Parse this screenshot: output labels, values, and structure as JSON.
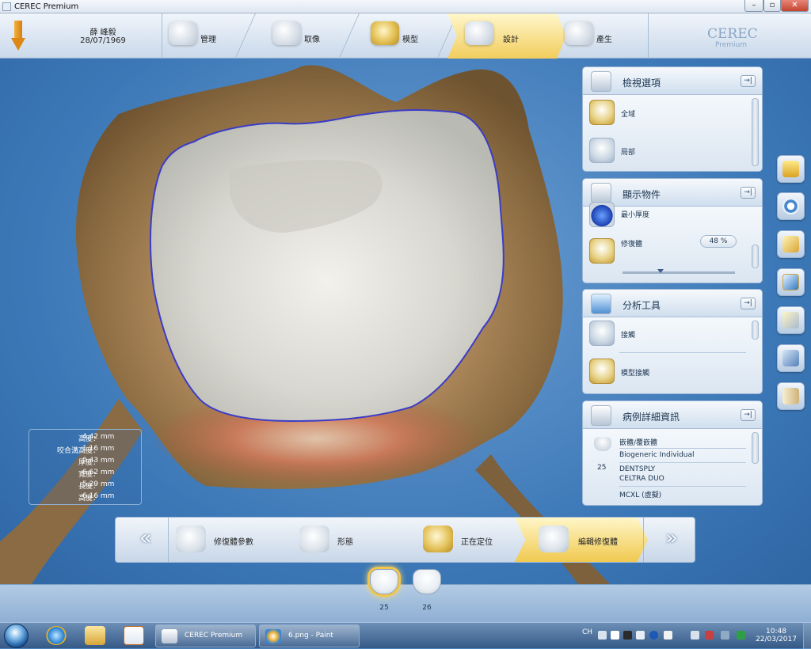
{
  "window": {
    "title": "CEREC Premium",
    "minimize": "–",
    "maximize": "▫",
    "close": "✕"
  },
  "patient": {
    "name": "薛 峰毅",
    "dob": "28/07/1969"
  },
  "workflow": {
    "steps": [
      {
        "label": "管理"
      },
      {
        "label": "取像"
      },
      {
        "label": "模型"
      },
      {
        "label": "設計",
        "active": true
      },
      {
        "label": "產生"
      }
    ]
  },
  "brand": {
    "logo": "CEREC",
    "sub": "Premium"
  },
  "measurements": [
    {
      "label": "高度：",
      "value": "4.42 mm"
    },
    {
      "label": "咬合溝高度：",
      "value": "1.16 mm"
    },
    {
      "label": "厚度：",
      "value": "0.43 mm"
    },
    {
      "label": "寬度：",
      "value": "6.62 mm"
    },
    {
      "label": "長度：",
      "value": "5.29 mm"
    },
    {
      "label": "高度：",
      "value": "6.16 mm"
    }
  ],
  "panels": {
    "view_options": {
      "title": "檢視選項",
      "items": [
        {
          "label": "全域"
        },
        {
          "label": "局部"
        }
      ]
    },
    "display_objects": {
      "title": "顯示物件",
      "items": [
        {
          "label": "最小厚度"
        },
        {
          "label": "修復體",
          "value": "48 %"
        }
      ],
      "transparency_level": 0.48
    },
    "analysis_tools": {
      "title": "分析工具",
      "items": [
        {
          "label": "接觸"
        },
        {
          "label": "模型接觸"
        }
      ]
    },
    "case_details": {
      "title": "病例詳細資訊",
      "type": "嵌體/覆嵌體",
      "design": "Biogeneric Individual",
      "tooth": "25",
      "material_maker": "DENTSPLY",
      "material_name": "CELTRA DUO",
      "material_option": "MCXL (虛擬)"
    }
  },
  "pin_icon": "→|",
  "design_steps": {
    "prev": "«",
    "next": "»",
    "steps": [
      {
        "label": "修復體參數"
      },
      {
        "label": "形態"
      },
      {
        "label": "正在定位"
      },
      {
        "label": "編輯修復體",
        "active": true
      }
    ]
  },
  "teeth": [
    {
      "number": "25",
      "selected": true
    },
    {
      "number": "26",
      "selected": false
    }
  ],
  "taskbar": {
    "tasks": [
      {
        "label": "CEREC Premium"
      },
      {
        "label": "6.png - Paint"
      }
    ],
    "lang": "CH",
    "time": "10:48",
    "date": "22/03/2017"
  },
  "colors": {
    "accent": "#f1c94f",
    "background": "#4b84c0",
    "tooth_enamel": "#dcdcd4",
    "gingiva_brown": "#8a6a40",
    "margin_line": "#3b3cc7"
  },
  "icons": [
    "app-icon",
    "download-arrow-icon",
    "pin-icon",
    "tooth-icon",
    "cube-icon",
    "start-orb-icon",
    "ie-icon",
    "explorer-icon",
    "media-player-icon",
    "paint-icon"
  ]
}
